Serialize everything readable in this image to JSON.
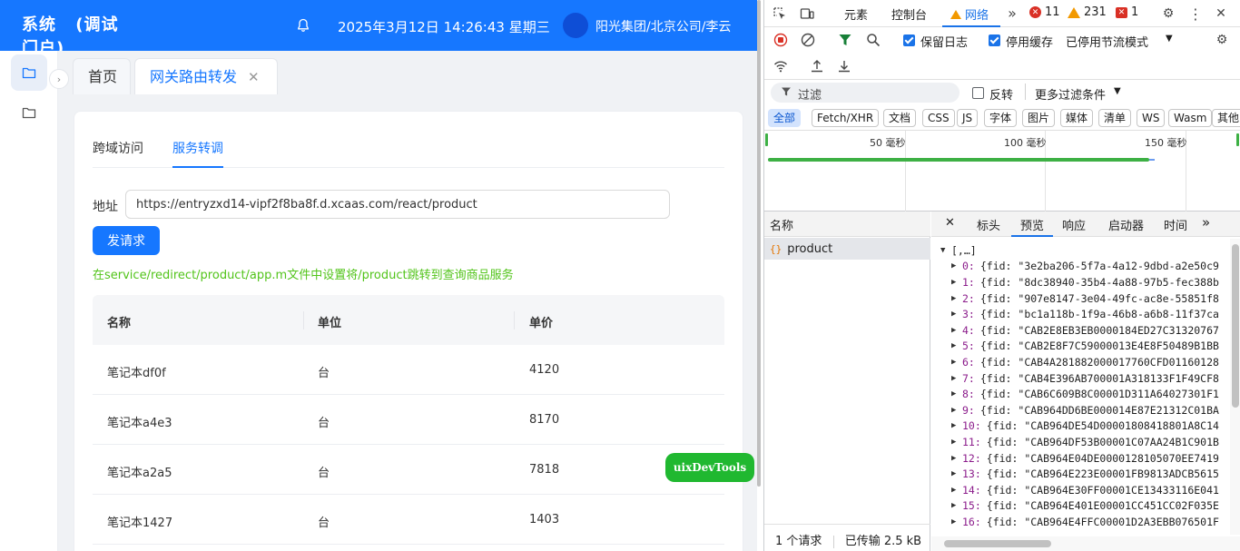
{
  "app": {
    "title": "系统 (调试门户)",
    "datetime": "2025年3月12日 14:26:43 星期三",
    "user_org": "阳光集团/北京公司/李云",
    "page_tabs": [
      {
        "label": "首页"
      },
      {
        "label": "网关路由转发",
        "close": "✕"
      }
    ],
    "inner_tabs": [
      {
        "label": "跨域访问"
      },
      {
        "label": "服务转调"
      }
    ],
    "address_label": "地址",
    "address_value": "https://entryzxd14-vipf2f8ba8f.d.xcaas.com/react/product",
    "send_label": "发请求",
    "hint": "在service/redirect/product/app.m文件中设置将/product跳转到查询商品服务",
    "table": {
      "headers": [
        "名称",
        "单位",
        "单价"
      ],
      "rows": [
        [
          "笔记本df0f",
          "台",
          "4120"
        ],
        [
          "笔记本a4e3",
          "台",
          "8170"
        ],
        [
          "笔记本a2a5",
          "台",
          "7818"
        ],
        [
          "笔记本1427",
          "台",
          "1403"
        ]
      ]
    },
    "floating_button": "uixDevTools",
    "colors": {
      "primary": "#1677ff",
      "hint": "#52c41a",
      "floating": "#20b830"
    }
  },
  "devtools": {
    "tabs": [
      "元素",
      "控制台",
      "网络"
    ],
    "badges": {
      "errors": "11",
      "warnings": "231",
      "issues": "1"
    },
    "preserve_log": "保留日志",
    "disable_cache": "停用缓存",
    "throttle": "已停用节流模式",
    "filter_placeholder": "过滤",
    "invert": "反转",
    "more_filters": "更多过滤条件",
    "type_chips": [
      "全部",
      "Fetch/XHR",
      "文档",
      "CSS",
      "JS",
      "字体",
      "图片",
      "媒体",
      "清单",
      "WS",
      "Wasm",
      "其他"
    ],
    "timeline_labels": [
      "50 毫秒",
      "100 毫秒",
      "150 毫秒"
    ],
    "name_header": "名称",
    "request_name": "product",
    "request_icon": "{}",
    "detail_tabs": [
      "标头",
      "预览",
      "响应",
      "启动器",
      "时间"
    ],
    "footer_requests": "1 个请求",
    "footer_transferred": "已传输 2.5 kB",
    "json_root": "[,…]",
    "json_rows": [
      {
        "k": "0",
        "v": "{fid: \"3e2ba206-5f7a-4a12-9dbd-a2e50c9"
      },
      {
        "k": "1",
        "v": "{fid: \"8dc38940-35b4-4a88-97b5-fec388b"
      },
      {
        "k": "2",
        "v": "{fid: \"907e8147-3e04-49fc-ac8e-55851f8"
      },
      {
        "k": "3",
        "v": "{fid: \"bc1a118b-1f9a-46b8-a6b8-11f37ca"
      },
      {
        "k": "4",
        "v": "{fid: \"CAB2E8EB3EB0000184ED27C31320767"
      },
      {
        "k": "5",
        "v": "{fid: \"CAB2E8F7C59000013E4E8F50489B1BB"
      },
      {
        "k": "6",
        "v": "{fid: \"CAB4A281882000017760CFD01160128"
      },
      {
        "k": "7",
        "v": "{fid: \"CAB4E396AB700001A318133F1F49CF8"
      },
      {
        "k": "8",
        "v": "{fid: \"CAB6C609B8C00001D311A64027301F1"
      },
      {
        "k": "9",
        "v": "{fid: \"CAB964DD6BE000014E87E21312C01BA"
      },
      {
        "k": "10",
        "v": "{fid: \"CAB964DE54D00001808418801A8C14"
      },
      {
        "k": "11",
        "v": "{fid: \"CAB964DF53B00001C07AA24B1C901B"
      },
      {
        "k": "12",
        "v": "{fid: \"CAB964E04DE0000128105070EE7419"
      },
      {
        "k": "13",
        "v": "{fid: \"CAB964E223E00001FB9813ADCB5615"
      },
      {
        "k": "14",
        "v": "{fid: \"CAB964E30FF00001CE13433116E041"
      },
      {
        "k": "15",
        "v": "{fid: \"CAB964E401E00001CC451CC02F035E"
      },
      {
        "k": "16",
        "v": "{fid: \"CAB964E4FFC00001D2A3EBB076501F"
      }
    ]
  }
}
